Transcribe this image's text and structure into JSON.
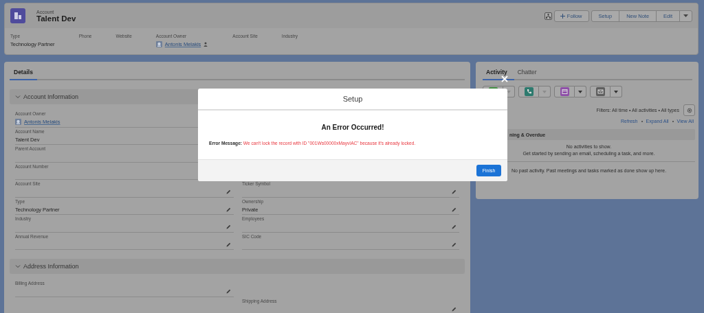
{
  "header": {
    "object_type": "Account",
    "title": "Talent Dev",
    "actions": [
      {
        "kind": "hierarchy"
      },
      {
        "kind": "follow",
        "label": "Follow"
      },
      {
        "kind": "button",
        "label": "Setup"
      },
      {
        "kind": "button",
        "label": "New Note"
      },
      {
        "kind": "button",
        "label": "Edit"
      },
      {
        "kind": "menu"
      }
    ],
    "highlights": [
      {
        "label": "Type",
        "value": "Technology Partner",
        "kind": "text"
      },
      {
        "label": "Phone"
      },
      {
        "label": "Website"
      },
      {
        "label": "Account Owner",
        "value": "Antonis Melakis",
        "kind": "user"
      },
      {
        "label": "Account Site"
      },
      {
        "label": "Industry"
      }
    ]
  },
  "details": {
    "tabs": [
      {
        "label": "Details",
        "selected": true
      }
    ],
    "sections": [
      {
        "title": "Account Information",
        "expanded": true,
        "left": [
          {
            "label": "Account Owner",
            "value": "Antonis Melakis",
            "kind": "user"
          },
          {
            "label": "Account Name",
            "value": "Talent Dev",
            "kind": "text"
          },
          {
            "label": "Parent Account"
          },
          {
            "label": "Account Number"
          },
          {
            "label": "Account Site",
            "editable": true
          },
          {
            "label": "Type",
            "value": "Technology Partner",
            "kind": "text",
            "editable": true
          },
          {
            "label": "Industry",
            "editable": true
          },
          {
            "label": "Annual Revenue",
            "editable": true
          }
        ],
        "right": [
          {
            "label": "Ticker Symbol",
            "editable": true
          },
          {
            "label": "Ownership",
            "value": "Private",
            "kind": "text",
            "editable": true
          },
          {
            "label": "Employees",
            "editable": true
          },
          {
            "label": "SIC Code",
            "editable": true
          }
        ]
      },
      {
        "title": "Address Information",
        "expanded": true,
        "left": [
          {
            "label": "Billing Address",
            "editable": true
          }
        ],
        "right": [
          {
            "label": "Shipping Address",
            "editable": true
          }
        ]
      }
    ]
  },
  "activity": {
    "tabs": [
      {
        "label": "Activity",
        "selected": true
      },
      {
        "label": "Chatter",
        "selected": false
      }
    ],
    "quick_actions": [
      {
        "kind": "task",
        "disabled": true
      },
      {
        "kind": "call",
        "disabled": true
      },
      {
        "kind": "event",
        "disabled": false
      },
      {
        "kind": "email",
        "disabled": false
      }
    ],
    "filters": "Filters: All time • All activities • All types",
    "links": [
      "Refresh",
      "Expand All",
      "View All"
    ],
    "section_title": "ning & Overdue",
    "empty_lines": [
      "No activities to show.",
      "Get started by sending an email, scheduling a task, and more."
    ],
    "past_note": "No past activity. Past meetings and tasks marked as done show up here."
  },
  "modal": {
    "title": "Setup",
    "heading": "An Error Occurred!",
    "error_label": "Error Message:",
    "error_text": "We can't lock the record with ID \"001Ws00000xMayvIAC\" because it's already locked.",
    "button": "Finish"
  }
}
